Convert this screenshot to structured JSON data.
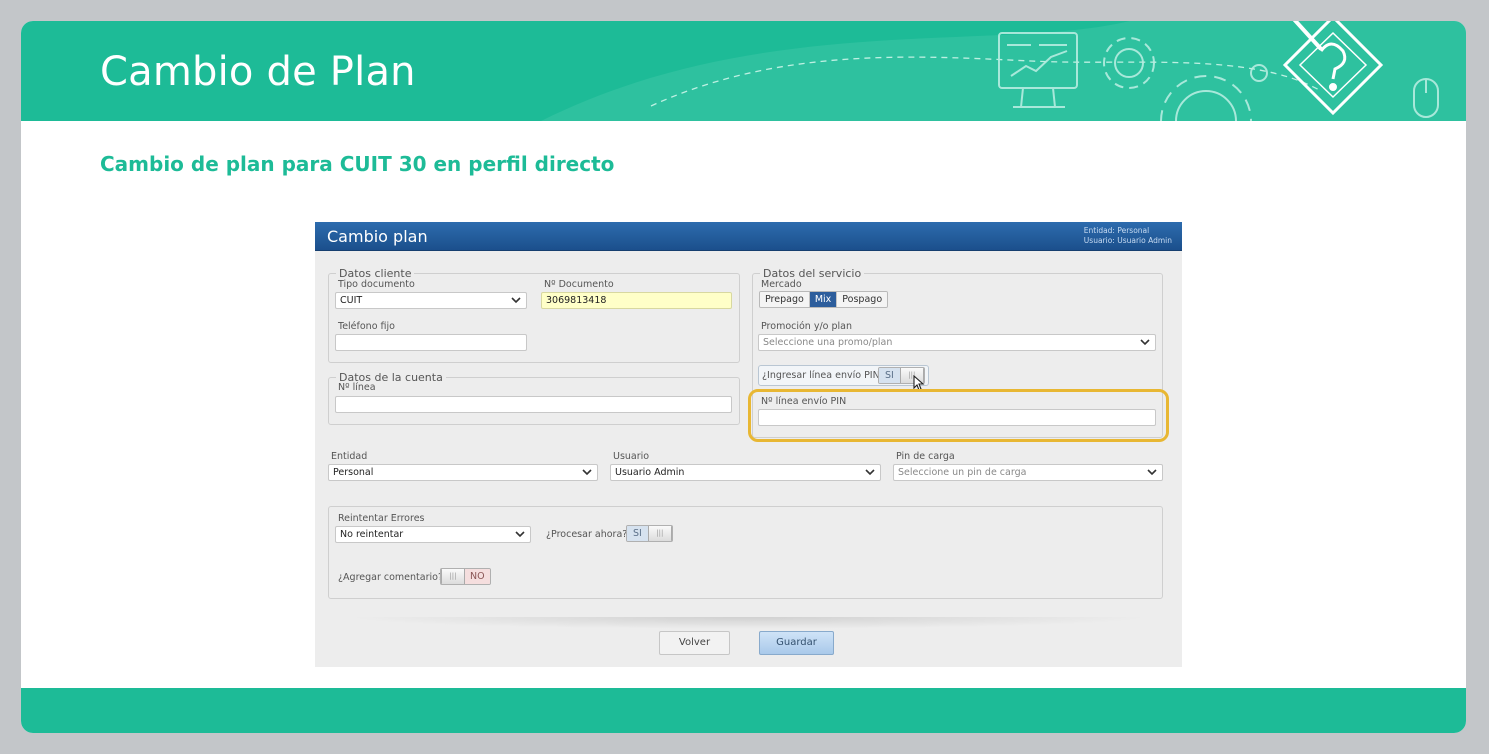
{
  "slide": {
    "title": "Cambio de Plan",
    "subtitle": "Cambio de plan para CUIT 30 en perfil directo",
    "accent_color": "#1dbb97"
  },
  "app": {
    "title": "Cambio plan",
    "entity_meta": "Entidad: Personal",
    "user_meta": "Usuario: Usuario Admin",
    "datos_cliente": {
      "legend": "Datos cliente",
      "tipo_documento_label": "Tipo documento",
      "tipo_documento_value": "CUIT",
      "nro_documento_label": "Nº Documento",
      "nro_documento_value": "3069813418",
      "telefono_label": "Teléfono fijo",
      "telefono_value": ""
    },
    "datos_cuenta": {
      "legend": "Datos de la cuenta",
      "nro_linea_label": "Nº línea",
      "nro_linea_value": ""
    },
    "datos_servicio": {
      "legend": "Datos del servicio",
      "mercado_label": "Mercado",
      "mercado_options": [
        "Prepago",
        "Mix",
        "Pospago"
      ],
      "mercado_selected": "Mix",
      "promocion_label": "Promoción y/o plan",
      "promocion_placeholder": "Seleccione una promo/plan",
      "ingresar_pin_label": "¿Ingresar línea envío PIN?",
      "ingresar_pin_state": "SI",
      "linea_pin_label": "Nº línea envío PIN",
      "linea_pin_value": ""
    },
    "entidad_label": "Entidad",
    "entidad_value": "Personal",
    "usuario_label": "Usuario",
    "usuario_value": "Usuario Admin",
    "pin_carga_label": "Pin de carga",
    "pin_carga_placeholder": "Seleccione un pin de carga",
    "reintentar_label": "Reintentar Errores",
    "reintentar_value": "No reintentar",
    "procesar_label": "¿Procesar ahora?",
    "procesar_state": "SI",
    "comentario_label": "¿Agregar comentario?",
    "comentario_state": "NO",
    "volver_label": "Volver",
    "guardar_label": "Guardar",
    "knob_glyph": "|||"
  }
}
